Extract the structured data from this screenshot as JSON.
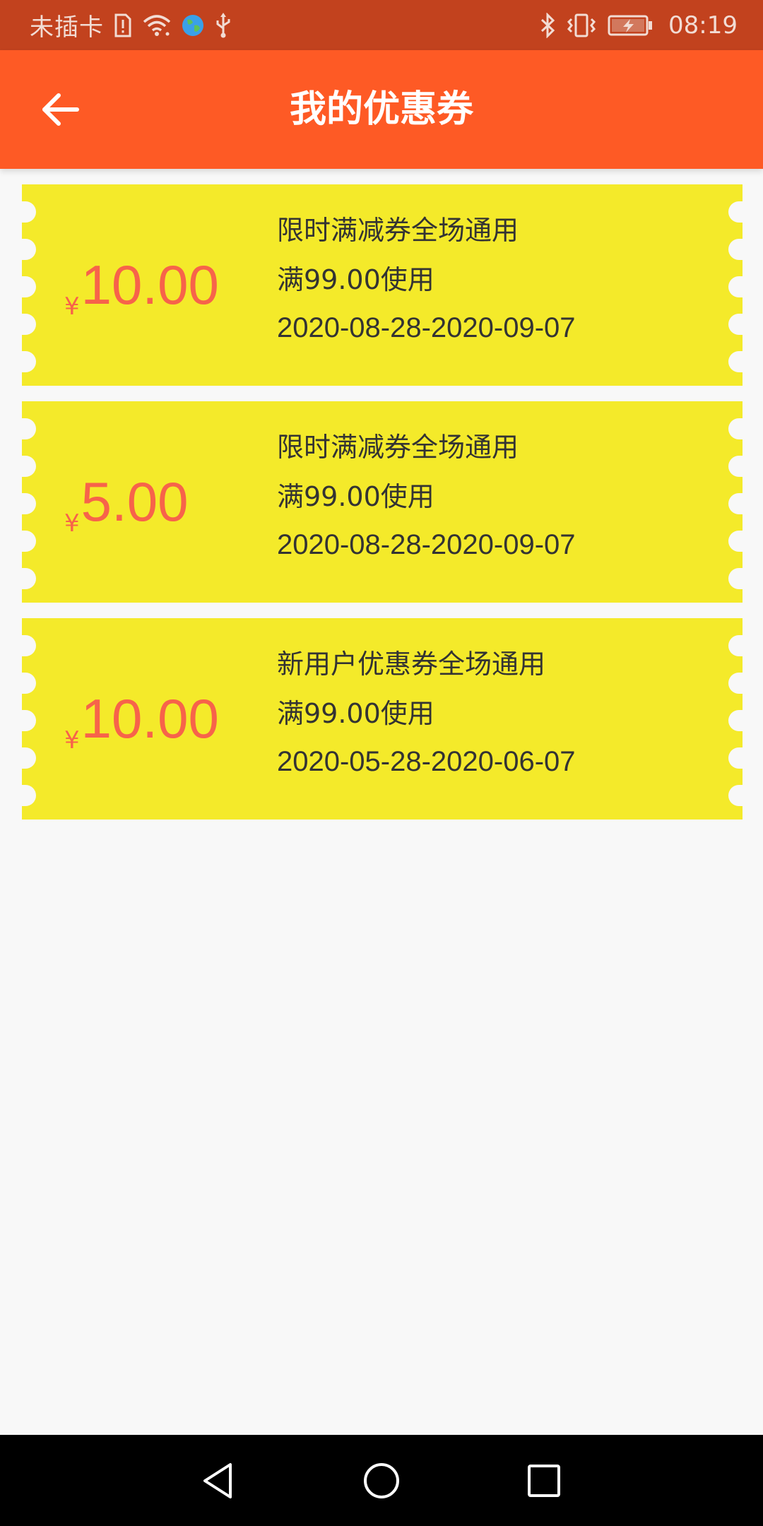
{
  "status_bar": {
    "carrier": "未插卡",
    "time": "08:19",
    "icons": [
      "sim-alert-icon",
      "wifi-icon",
      "globe-icon",
      "usb-icon",
      "bluetooth-icon",
      "vibrate-icon",
      "battery-charging-icon"
    ]
  },
  "app_bar": {
    "back_icon": "back-arrow-icon",
    "title": "我的优惠券"
  },
  "coupons": [
    {
      "currency": "¥",
      "amount": "10.00",
      "title": "限时满减券全场通用",
      "condition": "满99.00使用",
      "dates": "2020-08-28-2020-09-07"
    },
    {
      "currency": "¥",
      "amount": "5.00",
      "title": "限时满减券全场通用",
      "condition": "满99.00使用",
      "dates": "2020-08-28-2020-09-07"
    },
    {
      "currency": "¥",
      "amount": "10.00",
      "title": "新用户优惠券全场通用",
      "condition": "满99.00使用",
      "dates": "2020-05-28-2020-06-07"
    }
  ],
  "nav_bar": {
    "icons": [
      "back-triangle-icon",
      "home-circle-icon",
      "recents-square-icon"
    ]
  },
  "colors": {
    "status_bar": "#c2421e",
    "app_bar": "#fe5a25",
    "coupon_bg": "#f4ea2a",
    "amount": "#f7634a",
    "page_bg": "#f8f8f8",
    "nav_bar": "#000000"
  }
}
